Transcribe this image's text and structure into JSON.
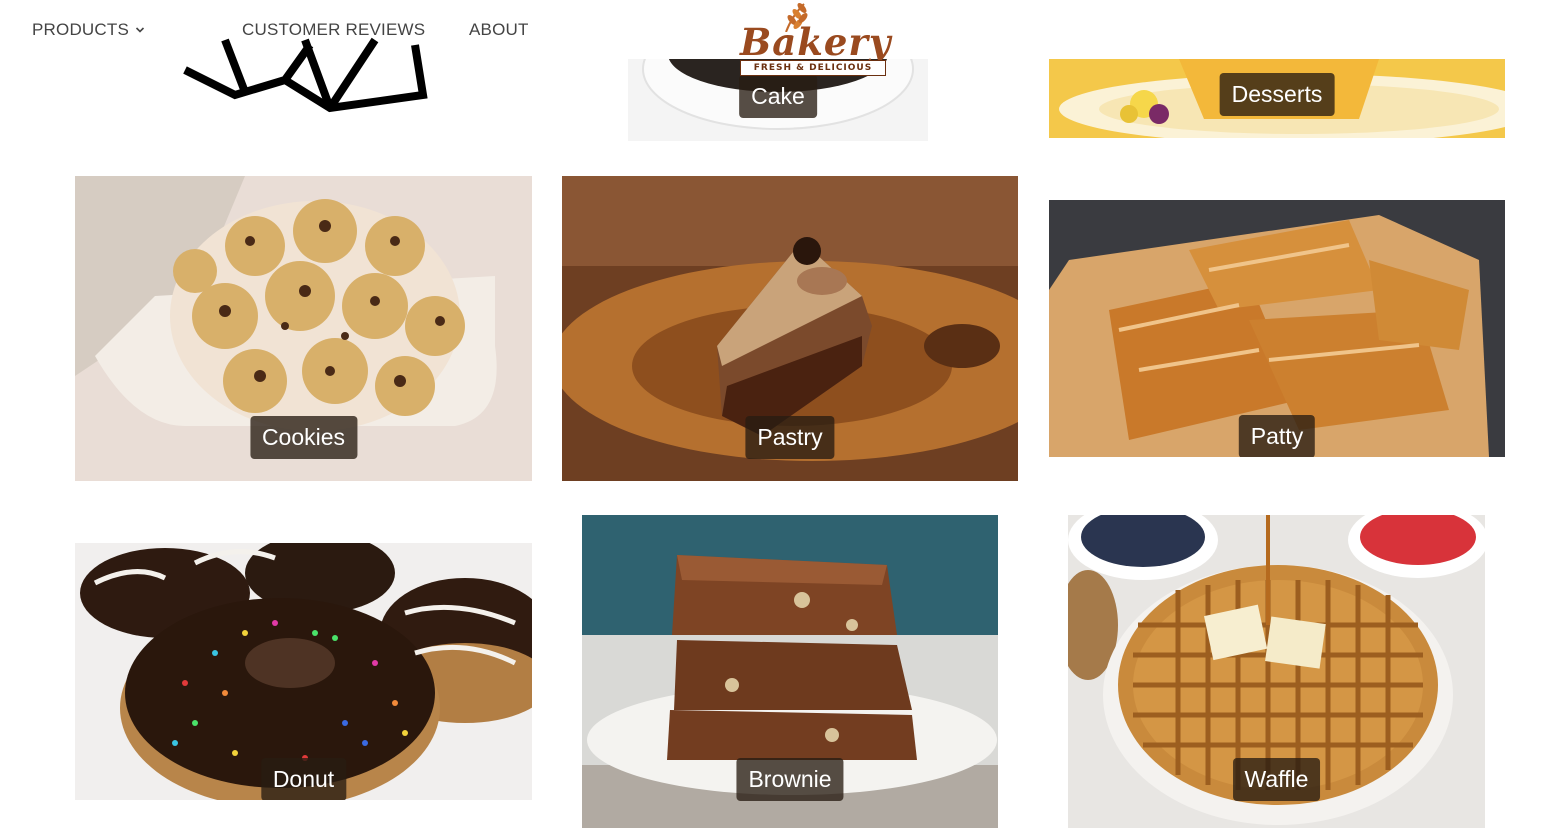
{
  "nav": {
    "products_label": "PRODUCTS",
    "reviews_label": "CUSTOMER REVIEWS",
    "about_label": "ABOUT"
  },
  "logo": {
    "name": "Bakery",
    "tagline": "FRESH & DELICIOUS"
  },
  "products": [
    {
      "label": "Cake"
    },
    {
      "label": "Desserts"
    },
    {
      "label": "Cookies"
    },
    {
      "label": "Pastry"
    },
    {
      "label": "Patty"
    },
    {
      "label": "Donut"
    },
    {
      "label": "Brownie"
    },
    {
      "label": "Waffle"
    }
  ],
  "icons": [
    "chevron-down-icon",
    "wheat-icon"
  ],
  "colors": {
    "nav_text": "#444444",
    "logo_brown": "#9a4a1f",
    "label_bg": "#281c12"
  }
}
